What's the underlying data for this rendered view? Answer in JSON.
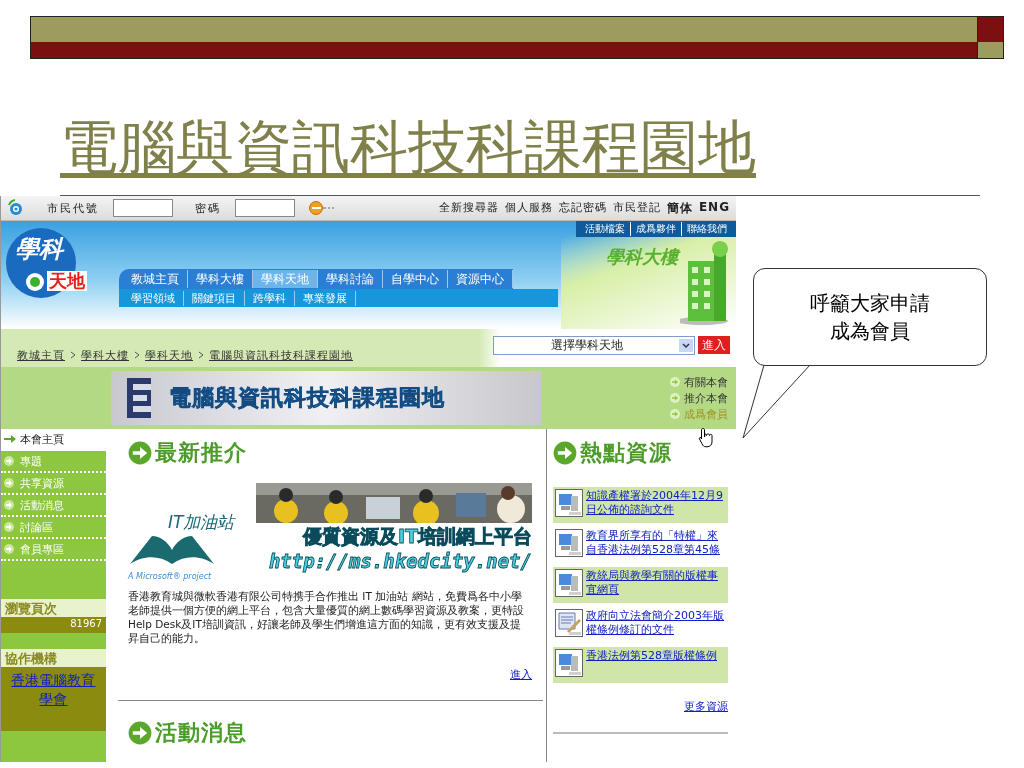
{
  "slide": {
    "title": "電腦與資訊科技科課程園地",
    "callout": "呼籲大家申請成為會員"
  },
  "toolbar": {
    "fields": [
      {
        "label": "市民代號"
      },
      {
        "label": "密碼"
      }
    ],
    "links": [
      {
        "label": "全新搜尋器",
        "kind": "plain"
      },
      {
        "label": "個人服務",
        "kind": "plain"
      },
      {
        "label": "忘記密碼",
        "kind": "plain"
      },
      {
        "label": "市民登記",
        "kind": "plain"
      },
      {
        "label": "簡体",
        "kind": "lang"
      },
      {
        "label": "ENG",
        "kind": "lang"
      }
    ]
  },
  "header": {
    "logo_top": "學科",
    "logo_bottom": "天地",
    "building_label": "學科大樓",
    "top_links": [
      "活動檔案",
      "成爲夥伴",
      "聯絡我們"
    ],
    "nav": [
      {
        "label": "教城主頁",
        "selected": false
      },
      {
        "label": "學科大樓",
        "selected": false
      },
      {
        "label": "學科天地",
        "selected": true
      },
      {
        "label": "學科討論",
        "selected": false
      },
      {
        "label": "自學中心",
        "selected": false
      },
      {
        "label": "資源中心",
        "selected": false
      }
    ],
    "subnav": [
      "學習領域",
      "關鍵項目",
      "跨學科",
      "專業發展"
    ]
  },
  "breadcrumb": [
    "教城主頁",
    "學科大樓",
    "學科天地",
    "電腦與資訊科技科課程園地"
  ],
  "site_select": {
    "value": "選擇學科天地",
    "button": "進入"
  },
  "banner": {
    "title": "電腦與資訊科技科課程園地",
    "links": [
      {
        "label": "有關本會",
        "hovered": false
      },
      {
        "label": "推介本會",
        "hovered": false
      },
      {
        "label": "成爲會員",
        "hovered": true
      }
    ]
  },
  "sidebar": {
    "items": [
      {
        "label": "本會主頁",
        "selected": true
      },
      {
        "label": "專題",
        "selected": false
      },
      {
        "label": "共享資源",
        "selected": false
      },
      {
        "label": "活動消息",
        "selected": false
      },
      {
        "label": "討論區",
        "selected": false
      },
      {
        "label": "會員專區",
        "selected": false
      }
    ],
    "counter": {
      "heading": "瀏覽頁次",
      "value": "81967"
    },
    "partners": {
      "heading": "協作機構",
      "link": "香港電腦教育學會"
    }
  },
  "main": {
    "heading": "最新推介",
    "featured": {
      "brand": "IT加油站",
      "sponsor": "A Microsoft® project",
      "tagline": "優質資源及IT培訓網上平台",
      "url": "http://ms.hkedcity.net/",
      "description": "香港教育城與微軟香港有限公司特携手合作推出 IT 加油站 網站，免費爲各中小學老師提供一個方便的網上平台，包含大量優質的網上數碼學習資源及教案，更特設Help Desk及IT培訓資訊，好讓老師及學生們增進這方面的知識，更有效支援及提昇自己的能力。",
      "more": "進入"
    },
    "heading_2": "活動消息"
  },
  "hot": {
    "heading": "熱點資源",
    "items": [
      {
        "text": "知識產權署於2004年12月9日公佈的諮詢文件",
        "kind": "web"
      },
      {
        "text": "教育界所享有的「特權」來自香港法例第528章第45條",
        "kind": "web"
      },
      {
        "text": "教統局與教學有關的版權事宜網頁",
        "kind": "web"
      },
      {
        "text": "政府向立法會簡介2003年版權條例修訂的文件",
        "kind": "doc"
      },
      {
        "text": "香港法例第528章版權條例",
        "kind": "web"
      }
    ],
    "more": "更多資源"
  }
}
